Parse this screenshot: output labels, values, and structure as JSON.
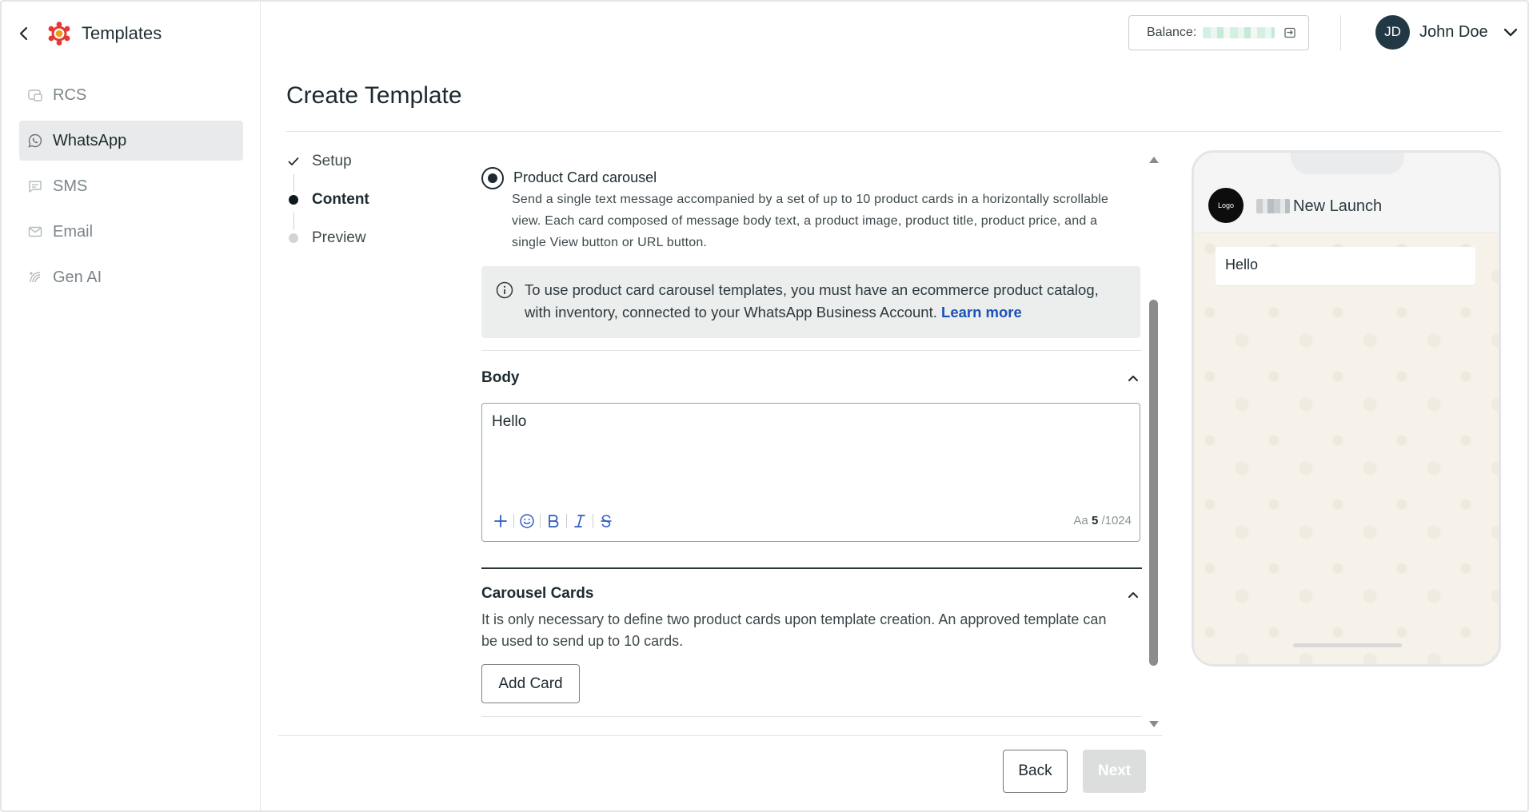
{
  "sidebar": {
    "title": "Templates",
    "items": [
      {
        "label": "RCS",
        "icon": "rcs-icon",
        "active": false
      },
      {
        "label": "WhatsApp",
        "icon": "whatsapp-icon",
        "active": true
      },
      {
        "label": "SMS",
        "icon": "sms-icon",
        "active": false
      },
      {
        "label": "Email",
        "icon": "email-icon",
        "active": false
      },
      {
        "label": "Gen AI",
        "icon": "gen-ai-icon",
        "active": false
      }
    ]
  },
  "header": {
    "balance_label": "Balance:",
    "user": {
      "initials": "JD",
      "name": "John Doe"
    }
  },
  "page": {
    "title": "Create Template"
  },
  "stepper": {
    "steps": [
      {
        "label": "Setup",
        "state": "done"
      },
      {
        "label": "Content",
        "state": "active"
      },
      {
        "label": "Preview",
        "state": "pending"
      }
    ]
  },
  "content": {
    "option": {
      "title": "Product Card carousel",
      "description": "Send a single text message accompanied by a set of up to 10 product cards in a horizontally scrollable view. Each card composed of message body text, a product image, product title, product price, and a single View button or URL button.",
      "selected": true
    },
    "info": {
      "text": "To use product card carousel templates, you must have an ecommerce product catalog, with inventory, connected to your WhatsApp Business Account.",
      "link": "Learn more"
    },
    "body": {
      "title": "Body",
      "value": "Hello",
      "counter_prefix": "Aa",
      "counter_current": "5",
      "counter_max": "/1024",
      "toolbar": [
        "add",
        "emoji",
        "bold",
        "italic",
        "strikethrough"
      ]
    },
    "carousel": {
      "title": "Carousel Cards",
      "description": "It is only necessary to define two product cards upon template creation. An approved template can be used to send up to 10 cards.",
      "add_label": "Add Card"
    }
  },
  "footer": {
    "back_label": "Back",
    "next_label": "Next"
  },
  "preview": {
    "logo_text": "Logo",
    "business_name": "New Launch",
    "message": "Hello"
  },
  "colors": {
    "accent_blue": "#1b51b8",
    "avatar_bg": "#233845",
    "active_nav_bg": "#e9eaeb",
    "disabled_btn": "#dcdddd"
  }
}
